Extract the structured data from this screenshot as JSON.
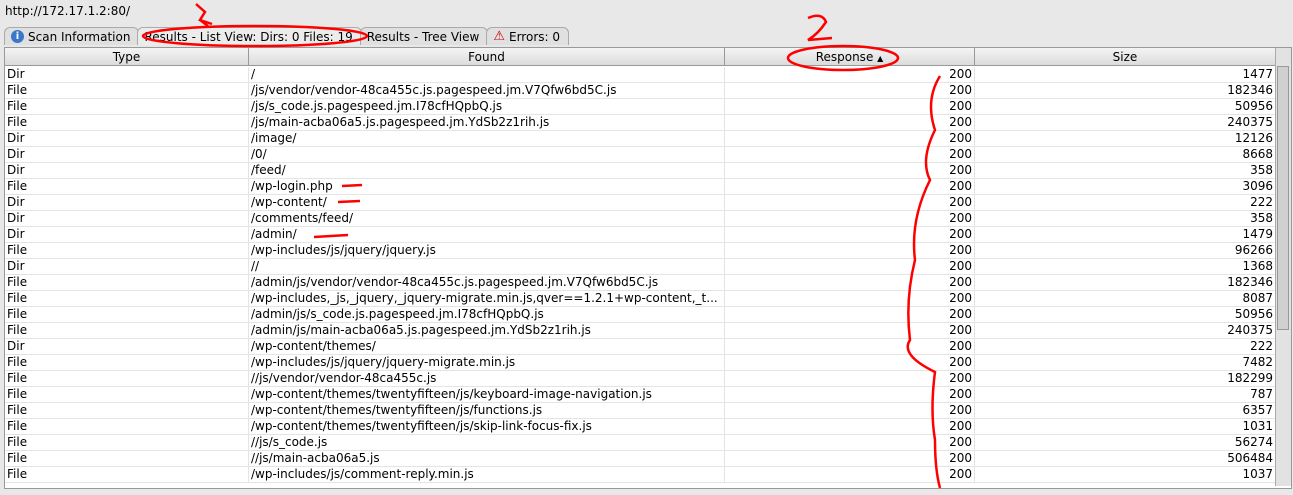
{
  "url": "http://172.17.1.2:80/",
  "tabs": [
    {
      "label": "Scan Information",
      "icon": "info-icon"
    },
    {
      "label": "Results - List View: Dirs: 0 Files: 19"
    },
    {
      "label": "Results - Tree View"
    },
    {
      "label": "Errors: 0",
      "icon": "warning-icon"
    }
  ],
  "columns": [
    "Type",
    "Found",
    "Response",
    "Size"
  ],
  "sort": {
    "column": "Response",
    "direction": "ascending"
  },
  "annotations": {
    "color": "#ff0000",
    "labels": [
      "1",
      "2"
    ]
  },
  "rows": [
    [
      "Dir",
      "/",
      "200",
      "1477"
    ],
    [
      "File",
      "/js/vendor/vendor-48ca455c.js.pagespeed.jm.V7Qfw6bd5C.js",
      "200",
      "182346"
    ],
    [
      "File",
      "/js/s_code.js.pagespeed.jm.I78cfHQpbQ.js",
      "200",
      "50956"
    ],
    [
      "File",
      "/js/main-acba06a5.js.pagespeed.jm.YdSb2z1rih.js",
      "200",
      "240375"
    ],
    [
      "Dir",
      "/image/",
      "200",
      "12126"
    ],
    [
      "Dir",
      "/0/",
      "200",
      "8668"
    ],
    [
      "Dir",
      "/feed/",
      "200",
      "358"
    ],
    [
      "File",
      "/wp-login.php",
      "200",
      "3096"
    ],
    [
      "Dir",
      "/wp-content/",
      "200",
      "222"
    ],
    [
      "Dir",
      "/comments/feed/",
      "200",
      "358"
    ],
    [
      "Dir",
      "/admin/",
      "200",
      "1479"
    ],
    [
      "File",
      "/wp-includes/js/jquery/jquery.js",
      "200",
      "96266"
    ],
    [
      "Dir",
      "//",
      "200",
      "1368"
    ],
    [
      "File",
      "/admin/js/vendor/vendor-48ca455c.js.pagespeed.jm.V7Qfw6bd5C.js",
      "200",
      "182346"
    ],
    [
      "File",
      "/wp-includes,_js,_jquery,_jquery-migrate.min.js,qver==1.2.1+wp-content,_t...",
      "200",
      "8087"
    ],
    [
      "File",
      "/admin/js/s_code.js.pagespeed.jm.I78cfHQpbQ.js",
      "200",
      "50956"
    ],
    [
      "File",
      "/admin/js/main-acba06a5.js.pagespeed.jm.YdSb2z1rih.js",
      "200",
      "240375"
    ],
    [
      "Dir",
      "/wp-content/themes/",
      "200",
      "222"
    ],
    [
      "File",
      "/wp-includes/js/jquery/jquery-migrate.min.js",
      "200",
      "7482"
    ],
    [
      "File",
      "//js/vendor/vendor-48ca455c.js",
      "200",
      "182299"
    ],
    [
      "File",
      "/wp-content/themes/twentyfifteen/js/keyboard-image-navigation.js",
      "200",
      "787"
    ],
    [
      "File",
      "/wp-content/themes/twentyfifteen/js/functions.js",
      "200",
      "6357"
    ],
    [
      "File",
      "/wp-content/themes/twentyfifteen/js/skip-link-focus-fix.js",
      "200",
      "1031"
    ],
    [
      "File",
      "//js/s_code.js",
      "200",
      "56274"
    ],
    [
      "File",
      "//js/main-acba06a5.js",
      "200",
      "506484"
    ],
    [
      "File",
      "/wp-includes/js/comment-reply.min.js",
      "200",
      "1037"
    ]
  ]
}
